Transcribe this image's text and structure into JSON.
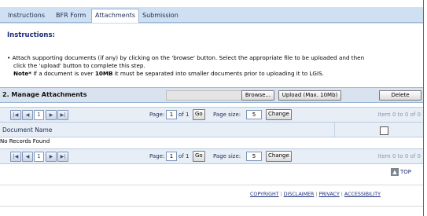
{
  "tabs": [
    "Instructions",
    "BFR Form",
    "Attachments",
    "Submission"
  ],
  "active_tab": "Attachments",
  "instructions": {
    "title": "Instructions:",
    "line1": "• Attach supporting documents (if any) by clicking on the 'browse' button. Select the appropriate file to be uploaded and then",
    "line2": "click the 'upload' button to complete this step.",
    "note_label": "Note*",
    "note_pre": " If a document is over ",
    "note_size": "10MB",
    "note_post": " it must be separated into smaller documents prior to uploading it to LGIS."
  },
  "manage": {
    "title": "2. Manage Attachments",
    "browse_label": "Browse...",
    "upload_label": "Upload (Max. 10Mb)",
    "delete_label": "Delete"
  },
  "pager": {
    "page_label": "Page:",
    "page_value": "1",
    "of_label": "of 1",
    "go_label": "Go",
    "size_label": "Page size:",
    "size_value": "5",
    "change_label": "Change",
    "current_page": "1",
    "item_text": "Item 0 to 0 of 0"
  },
  "grid": {
    "column_header": "Document Name",
    "empty_text": "No Records Found"
  },
  "top_link": "TOP",
  "footer": {
    "copyright": "COPYRIGHT",
    "disclaimer": "DISCLAIMER",
    "privacy": "PRIVACY",
    "accessibility": "ACCESSIBILITY"
  },
  "colors": {
    "tab_bar": "#cfe0f2",
    "heading_blue": "#1c2d7a",
    "section_bar": "#d9e3ef",
    "right_border": "#e03030"
  },
  "icons": {
    "first_page": "first-page-icon",
    "prev_page": "prev-page-icon",
    "next_page": "next-page-icon",
    "last_page": "last-page-icon",
    "top": "arrow-up-icon"
  }
}
